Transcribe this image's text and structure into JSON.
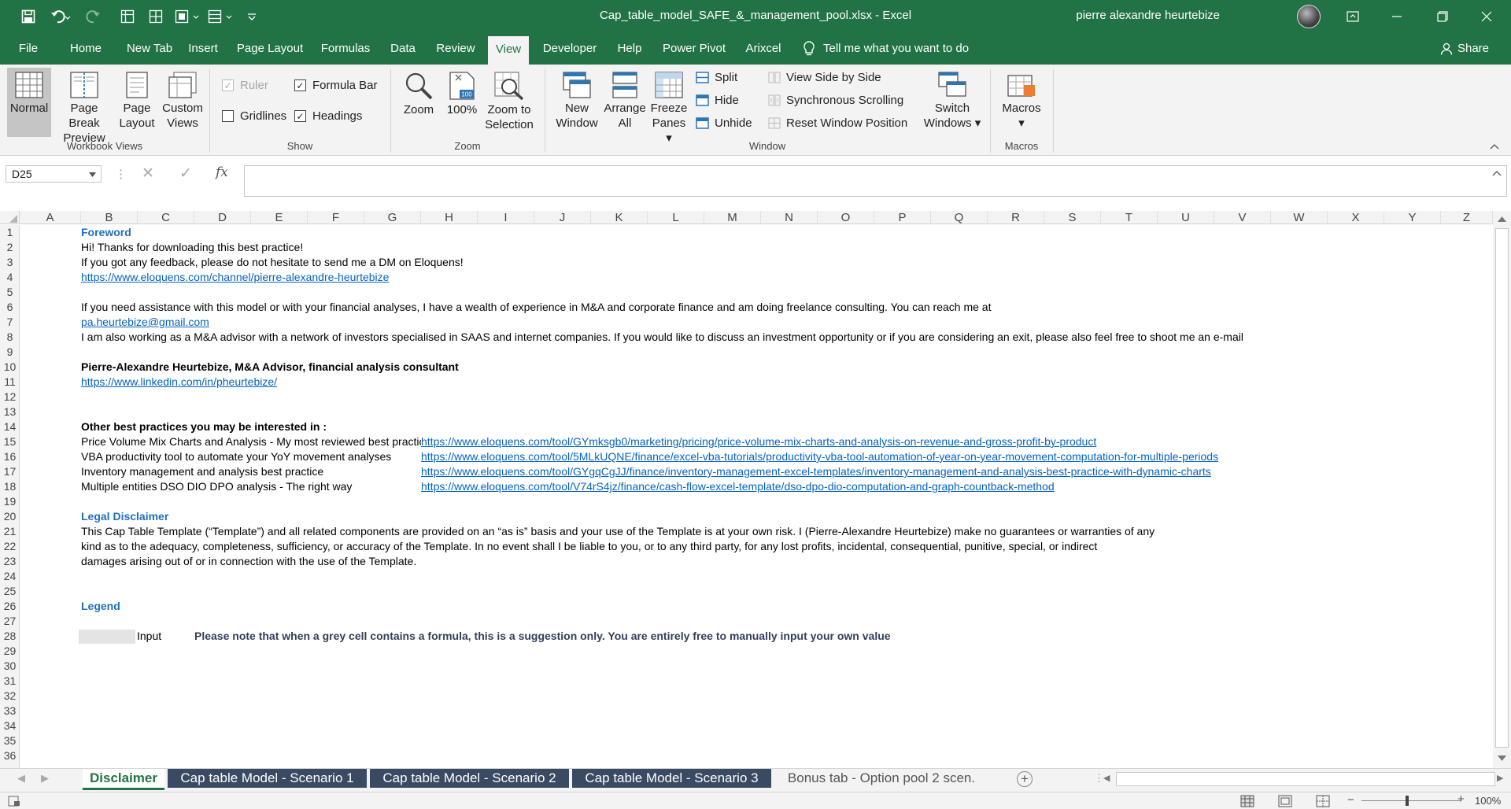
{
  "window": {
    "doc_title": "Cap_table_model_SAFE_&_management_pool.xlsx  -  Excel",
    "user_name": "pierre alexandre heurtebize"
  },
  "menu": {
    "tabs": [
      "File",
      "Home",
      "New Tab",
      "Insert",
      "Page Layout",
      "Formulas",
      "Data",
      "Review",
      "View",
      "Developer",
      "Help",
      "Power Pivot",
      "Arixcel"
    ],
    "active": "View",
    "tell_me": "Tell me what you want to do",
    "share": "Share"
  },
  "ribbon": {
    "workbook_views": {
      "label": "Workbook Views",
      "normal": "Normal",
      "page_break_1": "Page Break",
      "page_break_2": "Preview",
      "page_layout_1": "Page",
      "page_layout_2": "Layout",
      "custom_views_1": "Custom",
      "custom_views_2": "Views"
    },
    "show": {
      "label": "Show",
      "ruler": "Ruler",
      "formula_bar": "Formula Bar",
      "gridlines": "Gridlines",
      "headings": "Headings"
    },
    "zoom": {
      "label": "Zoom",
      "zoom": "Zoom",
      "hundred": "100%",
      "hundred_icon": "100",
      "zoom_sel_1": "Zoom to",
      "zoom_sel_2": "Selection"
    },
    "window": {
      "label": "Window",
      "new_window_1": "New",
      "new_window_2": "Window",
      "arrange_1": "Arrange",
      "arrange_2": "All",
      "freeze_1": "Freeze",
      "freeze_2": "Panes",
      "split": "Split",
      "hide": "Hide",
      "unhide": "Unhide",
      "view_side": "View Side by Side",
      "sync_scroll": "Synchronous Scrolling",
      "reset_pos": "Reset Window Position",
      "switch_1": "Switch",
      "switch_2": "Windows"
    },
    "macros": {
      "label": "Macros",
      "macros": "Macros"
    }
  },
  "formula_bar": {
    "name_box": "D25",
    "fx": "fx",
    "cancel": "✕",
    "enter": "✓",
    "formula": ""
  },
  "columns": [
    "A",
    "B",
    "C",
    "D",
    "E",
    "F",
    "G",
    "H",
    "I",
    "J",
    "K",
    "L",
    "M",
    "N",
    "O",
    "P",
    "Q",
    "R",
    "S",
    "T",
    "U",
    "V",
    "W",
    "X",
    "Y",
    "Z"
  ],
  "rows": [
    "1",
    "2",
    "3",
    "4",
    "5",
    "6",
    "7",
    "8",
    "9",
    "10",
    "11",
    "12",
    "13",
    "14",
    "15",
    "16",
    "17",
    "18",
    "19",
    "20",
    "21",
    "22",
    "23",
    "24",
    "25",
    "26",
    "27",
    "28",
    "29",
    "30",
    "31",
    "32",
    "33",
    "34",
    "35",
    "36"
  ],
  "cells": {
    "r1": "Foreword",
    "r2": "Hi! Thanks for downloading this best practice!",
    "r3": "If you got any feedback, please do not hesitate to send me a DM on Eloquens!",
    "r4": "https://www.eloquens.com/channel/pierre-alexandre-heurtebize",
    "r6": "If you need assistance with this model or with your financial analyses, I have a wealth of experience in M&A and corporate finance and am doing freelance consulting. You can reach me at",
    "r7": "pa.heurtebize@gmail.com",
    "r8": "I am also working as a M&A advisor with a network of investors specialised in SAAS and internet companies. If you would like to discuss an investment opportunity or if you are considering an exit, please also feel free to shoot me an e-mail",
    "r10": "Pierre-Alexandre Heurtebize, M&A Advisor, financial analysis consultant",
    "r11": "https://www.linkedin.com/in/pheurtebize/",
    "r14": "Other best practices you may be interested in :",
    "r15a": "Price Volume Mix Charts and Analysis - My most reviewed best practice",
    "r15b": "https://www.eloquens.com/tool/GYmksgb0/marketing/pricing/price-volume-mix-charts-and-analysis-on-revenue-and-gross-profit-by-product",
    "r16a": "VBA productivity tool to automate your YoY movement analyses",
    "r16b": "https://www.eloquens.com/tool/5MLkUQNE/finance/excel-vba-tutorials/productivity-vba-tool-automation-of-year-on-year-movement-computation-for-multiple-periods",
    "r17a": "Inventory management and analysis best practice",
    "r17b": "https://www.eloquens.com/tool/GYgqCgJJ/finance/inventory-management-excel-templates/inventory-management-and-analysis-best-practice-with-dynamic-charts",
    "r18a": "Multiple entities DSO DIO DPO analysis - The right way",
    "r18b": "https://www.eloquens.com/tool/V74rS4jz/finance/cash-flow-excel-template/dso-dpo-dio-computation-and-graph-countback-method",
    "r20": "Legal Disclaimer",
    "r21": "This Cap Table Template (“Template”) and all related components are provided on an “as is” basis and your use of the Template is at your own risk.  I (Pierre-Alexandre Heurtebize) make no guarantees or warranties of any",
    "r22": "kind as to the adequacy, completeness, sufficiency, or accuracy of the Template. In no event shall I be liable to you, or to any third party, for any lost profits, incidental, consequential, punitive, special, or indirect",
    "r23": "damages arising out of or in connection with the use of the Template.",
    "r26": "Legend",
    "r28a": "Input",
    "r28b": "Please note that when a grey cell contains a formula, this is a suggestion only. You are entirely free to manually input your own value"
  },
  "sheet_tabs": [
    "Disclaimer",
    "Cap table Model - Scenario 1",
    "Cap table Model - Scenario 2",
    "Cap table Model - Scenario 3",
    "Bonus tab - Option pool 2 scen."
  ],
  "status": {
    "zoom": "100%"
  },
  "colors": {
    "excel_green": "#217346",
    "heading_blue": "#1f6fbf",
    "link": "#0563c1",
    "tab_navy": "#3a4a63"
  }
}
